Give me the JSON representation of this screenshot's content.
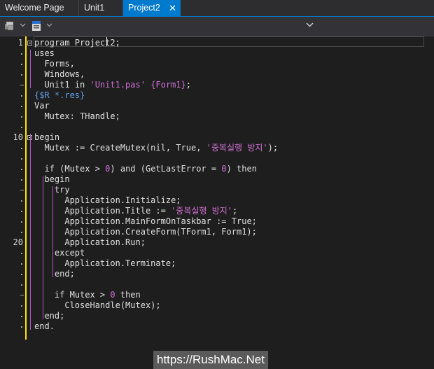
{
  "tabs": [
    {
      "label": "Welcome Page"
    },
    {
      "label": "Unit1"
    },
    {
      "label": "Project2",
      "close": "✕"
    }
  ],
  "toolbar": {
    "icons": [
      "component-icon",
      "unit-view-icon"
    ]
  },
  "gutter": {
    "numbers": [
      {
        "line": 1,
        "label": "1"
      },
      {
        "line": 10,
        "label": "10"
      },
      {
        "line": 20,
        "label": "20"
      }
    ]
  },
  "code": {
    "lines": [
      "program Project2;",
      "uses",
      "  Forms,",
      "  Windows,",
      "  Unit1 in 'Unit1.pas' {Form1};",
      "{$R *.res}",
      "Var",
      "  Mutex: THandle;",
      "",
      "begin",
      "  Mutex := CreateMutex(nil, True, '중복실행 방지');",
      "",
      "  if (Mutex > 0) and (GetLastError = 0) then",
      "  begin",
      "    try",
      "      Application.Initialize;",
      "      Application.Title := '중복실행 방지';",
      "      Application.MainFormOnTaskbar := True;",
      "      Application.CreateForm(TForm1, Form1);",
      "      Application.Run;",
      "    except",
      "      Application.Terminate;",
      "    end;",
      "",
      "    if Mutex > 0 then",
      "      CloseHandle(Mutex);",
      "  end;",
      "end."
    ]
  },
  "watermark": "https://RushMac.Net",
  "colors": {
    "background": "#1e1e1e",
    "active_tab": "#007acc",
    "string": "#cf6fd2",
    "directive": "#5fa0e8",
    "change_bar": "#ffe400"
  }
}
